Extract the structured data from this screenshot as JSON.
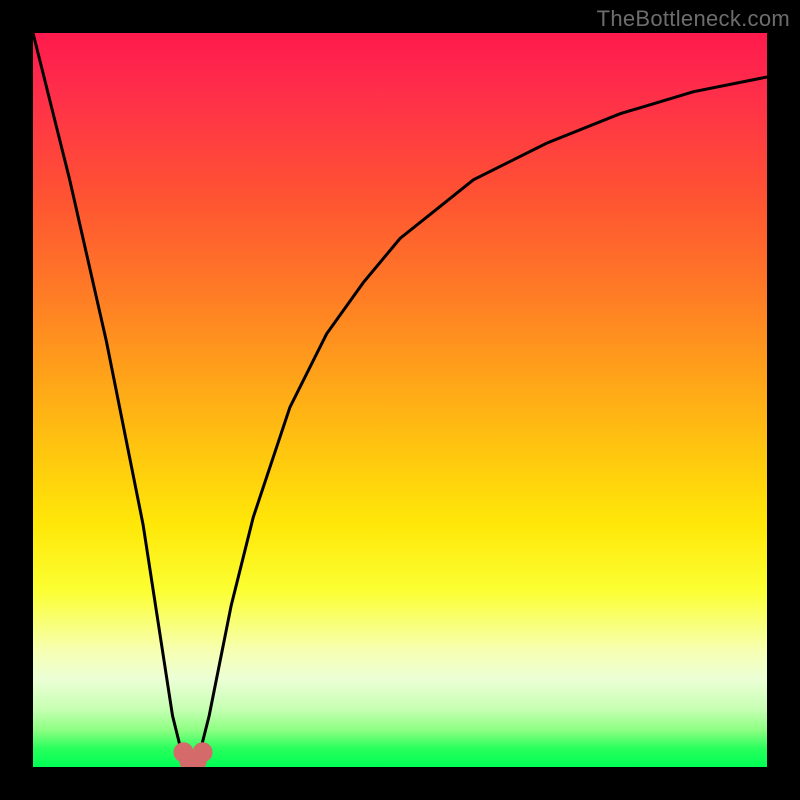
{
  "watermark": "TheBottleneck.com",
  "chart_data": {
    "type": "line",
    "title": "",
    "xlabel": "",
    "ylabel": "",
    "xlim": [
      0,
      100
    ],
    "ylim": [
      0,
      100
    ],
    "grid": false,
    "legend": false,
    "series": [
      {
        "name": "curve",
        "x": [
          0,
          5,
          10,
          15,
          17,
          19,
          20,
          21,
          22,
          23,
          24,
          25,
          27,
          30,
          35,
          40,
          45,
          50,
          55,
          60,
          70,
          80,
          90,
          100
        ],
        "y": [
          100,
          80,
          58,
          33,
          20,
          7,
          3,
          1,
          1,
          3,
          7,
          12,
          22,
          34,
          49,
          59,
          66,
          72,
          76,
          80,
          85,
          89,
          92,
          94
        ]
      }
    ],
    "markers": [
      {
        "name": "min-region-left",
        "x": 20.5,
        "y": 2.0
      },
      {
        "name": "min-region-mid-l",
        "x": 21.3,
        "y": 0.8
      },
      {
        "name": "min-region-mid-r",
        "x": 22.3,
        "y": 0.8
      },
      {
        "name": "min-region-right",
        "x": 23.1,
        "y": 2.0
      }
    ],
    "colors": {
      "curve": "#000000",
      "marker": "#d46a6a",
      "gradient_top": "#ff1a4d",
      "gradient_mid": "#ffe808",
      "gradient_bottom": "#00ff55"
    }
  }
}
